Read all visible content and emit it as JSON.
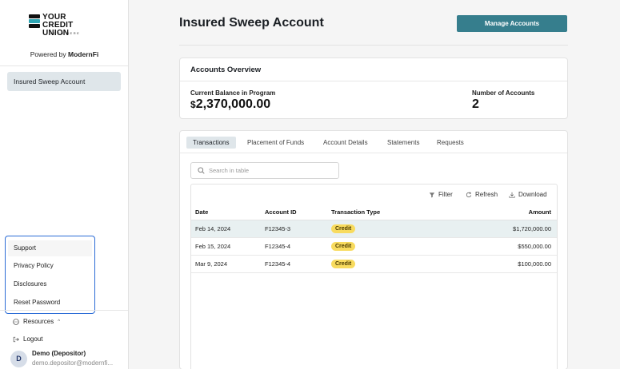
{
  "sidebar": {
    "logo": {
      "line1": "YOUR",
      "line2": "CREDIT UNION",
      "tagline": "LOGO HERE"
    },
    "powered_by": {
      "prefix": "Powered by",
      "brand": "ModernFi"
    },
    "nav": [
      {
        "label": "Insured Sweep Account",
        "active": true
      }
    ],
    "resources_menu": {
      "items": [
        "Support",
        "Privacy Policy",
        "Disclosures",
        "Reset Password"
      ]
    },
    "resources_label": "Resources",
    "logout_label": "Logout",
    "user": {
      "initial": "D",
      "name": "Demo (Depositor)",
      "email": "demo.depositor@modernfi..."
    }
  },
  "main": {
    "title": "Insured Sweep Account",
    "manage_button": "Manage Accounts",
    "overview": {
      "title": "Accounts Overview",
      "balance_label": "Current Balance in Program",
      "balance_currency": "$",
      "balance_value": "2,370,000.00",
      "accounts_label": "Number of Accounts",
      "accounts_value": "2"
    },
    "tabs": [
      {
        "label": "Transactions",
        "active": true
      },
      {
        "label": "Placement of Funds",
        "active": false
      },
      {
        "label": "Account Details",
        "active": false
      },
      {
        "label": "Statements",
        "active": false
      },
      {
        "label": "Requests",
        "active": false
      }
    ],
    "search": {
      "placeholder": "Search in table",
      "value": ""
    },
    "toolbar": {
      "filter": "Filter",
      "refresh": "Refresh",
      "download": "Download"
    },
    "table": {
      "columns": [
        "Date",
        "Account ID",
        "Transaction Type",
        "Amount"
      ],
      "rows": [
        {
          "date": "Feb 14, 2024",
          "account_id": "F12345-3",
          "type": "Credit",
          "amount": "$1,720,000.00",
          "highlighted": true
        },
        {
          "date": "Feb 15, 2024",
          "account_id": "F12345-4",
          "type": "Credit",
          "amount": "$550,000.00",
          "highlighted": false
        },
        {
          "date": "Mar 9, 2024",
          "account_id": "F12345-4",
          "type": "Credit",
          "amount": "$100,000.00",
          "highlighted": false
        }
      ]
    }
  },
  "colors": {
    "accent": "#367e8d",
    "active_bg": "#dfe6ea",
    "badge": "#f8db5e",
    "focus_outline": "#2b6cd6",
    "logo_teal": "#2fa6b4"
  },
  "icons": {
    "filter": "filter-icon",
    "refresh": "refresh-icon",
    "download": "download-icon",
    "search": "search-icon",
    "resources": "more-circle-icon",
    "logout": "logout-icon"
  }
}
